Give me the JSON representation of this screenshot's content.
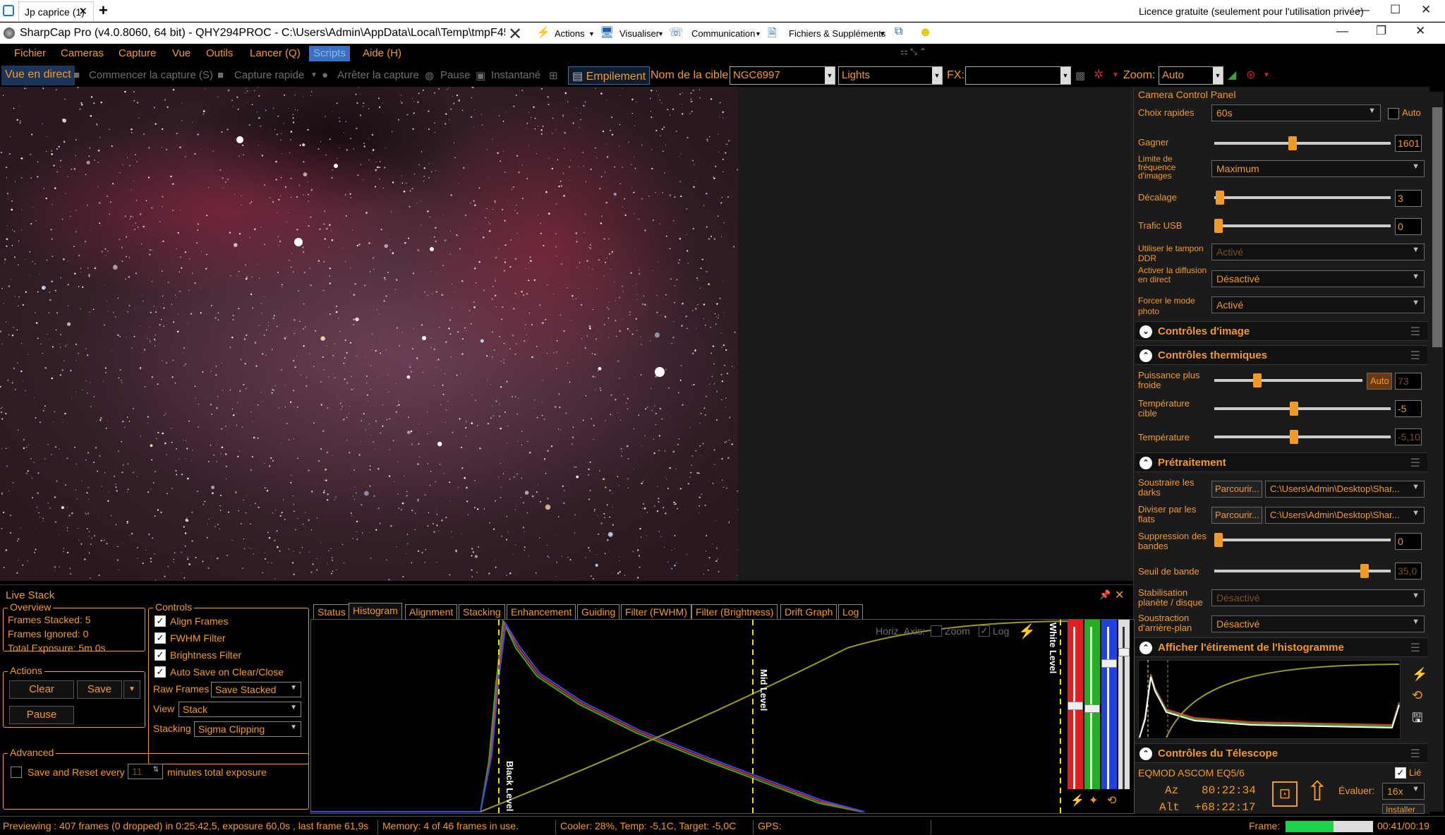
{
  "rdp": {
    "tab_label": "Jp caprice (1)",
    "licence": "Licence gratuite (seulement pour l'utilisation privée)"
  },
  "app": {
    "title": "SharpCap Pro (v4.0.8060, 64 bit) - QHY294PROC - C:\\Users\\Admin\\AppData\\Local\\Temp\\tmpF452.tmp.p",
    "toolstrip": {
      "actions": "Actions",
      "visualiser": "Visualiser",
      "communication": "Communication",
      "fichiers": "Fichiers & Suppléments"
    }
  },
  "menu": [
    "Fichier",
    "Cameras",
    "Capture",
    "Vue",
    "Outils",
    "Lancer (Q)",
    "Scripts",
    "Aide (H)"
  ],
  "toolbar": {
    "live": "Vue en direct",
    "start": "Commencer la capture (S)",
    "quick": "Capture rapide",
    "stop": "Arrêter la capture",
    "pause": "Pause",
    "snapshot": "Instantané",
    "stack": "Empilement",
    "target_label": "Nom de la cible:",
    "target": "NGC6997",
    "frame_type": "Lights",
    "fx_label": "FX:",
    "zoom_label": "Zoom:",
    "zoom": "Auto"
  },
  "camera_panel": {
    "title": "Camera Control Panel",
    "quick_label": "Choix rapides",
    "quick_value": "60s",
    "auto_label": "Auto",
    "gain_label": "Gagner",
    "gain": "1601",
    "gain_level": 0.44,
    "fps_label": "Limite de fréquence d'images",
    "fps": "Maximum",
    "offset_label": "Décalage",
    "offset": "3",
    "offset_level": 0.01,
    "usb_label": "Trafic USB",
    "usb": "0",
    "usb_level": 0.0,
    "ddr_label": "Utiliser le tampon DDR",
    "ddr": "Activé",
    "broadcast_label": "Activer la diffusion en direct",
    "broadcast": "Désactivé",
    "photo_label": "Forcer le mode photo",
    "photo": "Activé"
  },
  "sections": {
    "image": "Contrôles d'image",
    "thermal": "Contrôles thermiques",
    "pre": "Prétraitement",
    "hist": "Afficher l'étirement de l'histogramme",
    "scope": "Contrôles du Télescope"
  },
  "thermal": {
    "power_label": "Puissance plus froide",
    "power_auto": "Auto",
    "power": "73",
    "power_level": 0.28,
    "target_label": "Température cible",
    "target": "-5",
    "target_level": 0.45,
    "temp_label": "Température",
    "temp": "-5,10",
    "temp_level": 0.45
  },
  "pre": {
    "darks_label": "Soustraire les darks",
    "darks_btn": "Parcourir...",
    "darks_path": "C:\\Users\\Admin\\Desktop\\Shar...",
    "flats_label": "Diviser par les flats",
    "flats_btn": "Parcourir...",
    "flats_path": "C:\\Users\\Admin\\Desktop\\Shar...",
    "band_label": "Suppression des bandes",
    "band": "0",
    "band_level": 0.0,
    "thresh_label": "Seuil de bande",
    "thresh": "35,0",
    "thresh_level": 0.87,
    "stab_label": "Stabilisation planète / disque",
    "stab": "Désactivé",
    "bg_label": "Soustraction d'arrière-plan",
    "bg": "Désactivé"
  },
  "scope": {
    "mount": "EQMOD ASCOM EQ5/6",
    "linked": "Lié",
    "az_label": "Az",
    "az": "80:22:34",
    "alt_label": "Alt",
    "alt": "+68:22:17",
    "rate_label": "Évaluer:",
    "rate": "16x",
    "install": "Installer"
  },
  "live_stack": {
    "title": "Live Stack",
    "overview": "Overview",
    "stacked": "Frames Stacked:  5",
    "ignored": "Frames Ignored:  0",
    "exposure": "Total Exposure:   5m 0s",
    "actions": "Actions",
    "clear": "Clear",
    "save": "Save",
    "pause": "Pause",
    "controls": "Controls",
    "align": "Align Frames",
    "fwhm": "FWHM Filter",
    "brightness": "Brightness Filter",
    "autosave": "Auto Save on Clear/Close",
    "raw_label": "Raw Frames",
    "raw": "Save Stacked",
    "view_label": "View",
    "view": "Stack",
    "stacking_label": "Stacking",
    "stacking": "Sigma Clipping",
    "advanced": "Advanced",
    "save_reset": "Save and Reset every",
    "minutes": "11",
    "minutes_label": "minutes total exposure",
    "tabs": [
      "Status",
      "Histogram",
      "Alignment",
      "Stacking",
      "Enhancement",
      "Guiding",
      "Filter (FWHM)",
      "Filter (Brightness)",
      "Drift Graph",
      "Log"
    ],
    "axis_label": "Horiz. Axis:",
    "zoom": "Zoom",
    "log": "Log",
    "black_level": "Black Level",
    "mid_level": "Mid Level",
    "white_level": "White Level"
  },
  "status": {
    "preview": "Previewing : 407 frames (0 dropped) in 0:25:42,5, exposure 60,0s , last frame 61,9s",
    "memory": "Memory: 4 of 46 frames in use.",
    "cooler": "Cooler: 28%, Temp: -5,1C, Target: -5,0C",
    "gps": "GPS:",
    "frame_label": "Frame:",
    "frame_progress": 0.55,
    "frame_time": "00:41/00:19"
  },
  "colors": {
    "accent": "#f29a26",
    "panel": "#1b1b1b",
    "highlight": "#3a72c2"
  }
}
